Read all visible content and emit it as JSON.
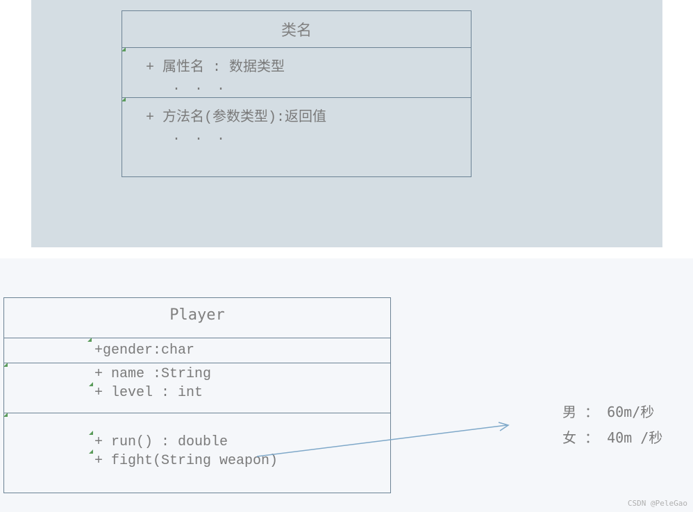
{
  "diagram1": {
    "title": "类名",
    "attribute_line": "+ 属性名 :  数据类型",
    "ellipsis1": ". . .",
    "method_line": "+ 方法名(参数类型):返回值",
    "ellipsis2": ". . ."
  },
  "diagram2": {
    "title": "Player",
    "attr1": "+gender:char",
    "attr2": "+ name :String",
    "attr3": "+ level : int",
    "method1": "+ run() : double",
    "method2": "+ fight(String weapon)"
  },
  "annotation": {
    "line1": "男 ：  60m/秒",
    "line2": "女 ：  40m /秒"
  },
  "watermark": "CSDN @PeleGao"
}
